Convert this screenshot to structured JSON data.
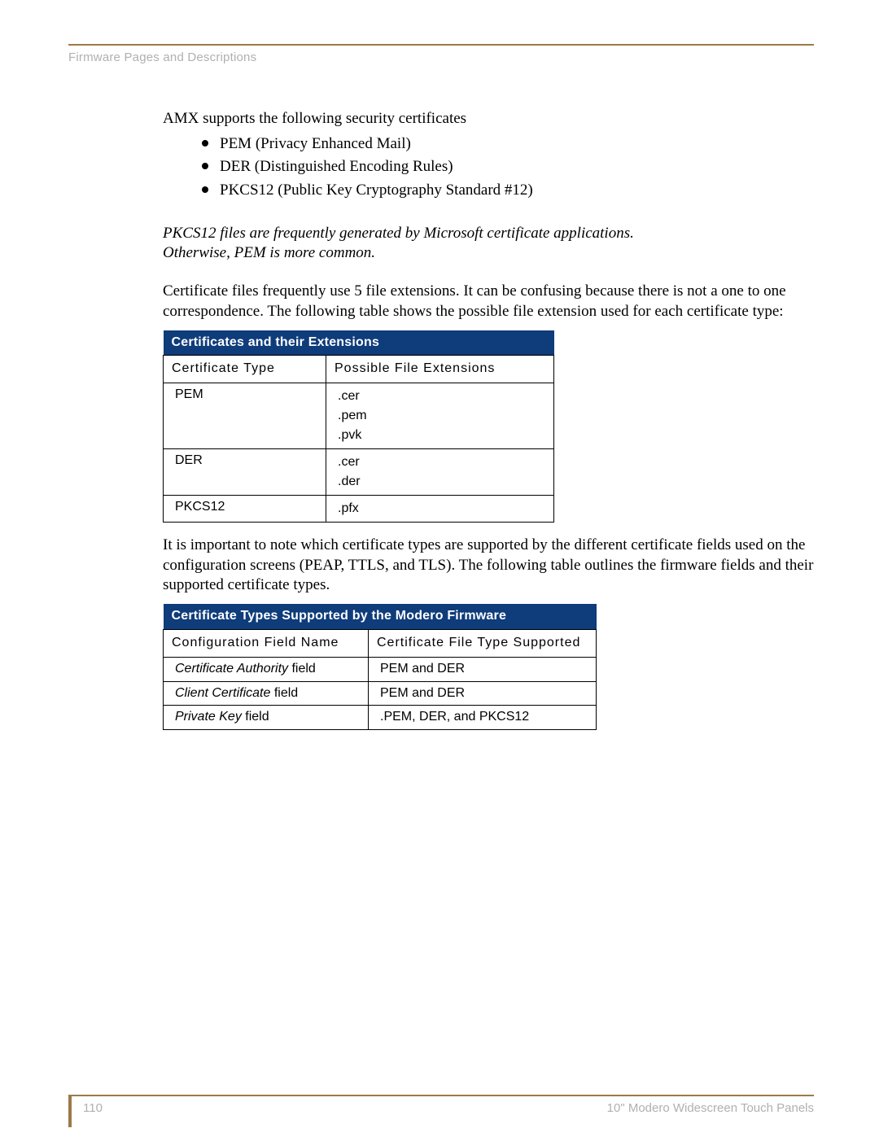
{
  "header": {
    "section_label": "Firmware Pages and Descriptions"
  },
  "body": {
    "intro": "AMX supports the following security certificates",
    "bullets": [
      "PEM (Privacy Enhanced Mail)",
      "DER (Distinguished Encoding Rules)",
      "PKCS12 (Public Key Cryptography Standard #12)"
    ],
    "note_line1": "PKCS12 files are frequently generated by Microsoft certificate applications.",
    "note_line2": "Otherwise, PEM is more common.",
    "para2": "Certificate files frequently use 5 file extensions. It can be confusing because there is not a one to one correspondence. The following table shows the possible file extension used for each certificate type:",
    "para3": "It is important to note which certificate types are supported by the different certificate fields used on the configuration screens (PEAP, TTLS, and TLS). The following table outlines the firmware fields and their supported certificate types."
  },
  "table1": {
    "title": "Certificates and their Extensions",
    "col1": "Certificate Type",
    "col2": "Possible File Extensions",
    "rows": [
      {
        "type": "PEM",
        "exts": [
          ".cer",
          ".pem",
          ".pvk"
        ]
      },
      {
        "type": "DER",
        "exts": [
          ".cer",
          ".der"
        ]
      },
      {
        "type": "PKCS12",
        "exts": [
          ".pfx"
        ]
      }
    ]
  },
  "table2": {
    "title": "Certificate Types Supported by the Modero Firmware",
    "col1": "Configuration Field Name",
    "col2": "Certificate File Type Supported",
    "rows": [
      {
        "name_italic": "Certificate Authority",
        "name_rest": " field",
        "supported": "PEM and DER"
      },
      {
        "name_italic": "Client Certificate",
        "name_rest": " field",
        "supported": "PEM and DER"
      },
      {
        "name_italic": "Private Key",
        "name_rest": " field",
        "supported": ".PEM, DER, and PKCS12"
      }
    ]
  },
  "footer": {
    "page_number": "110",
    "doc_title": "10\" Modero Widescreen Touch Panels"
  }
}
